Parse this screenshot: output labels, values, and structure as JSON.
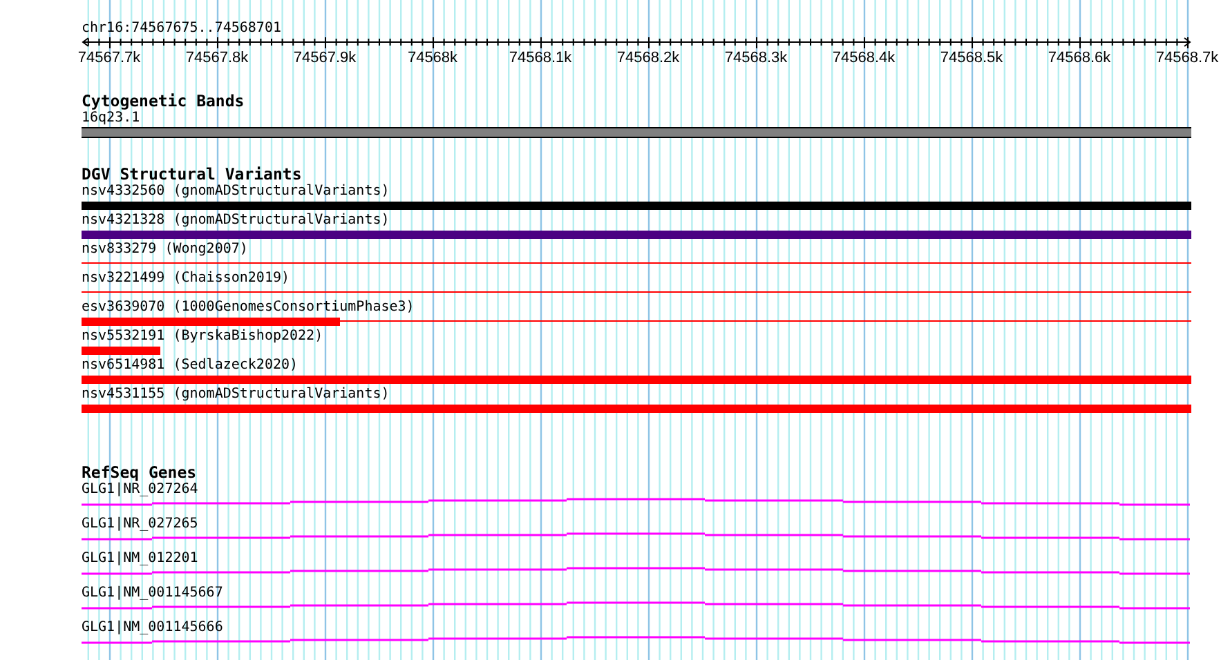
{
  "region": "chr16:74567675..74568701",
  "ruler": {
    "ticks": [
      "74567.7k",
      "74567.8k",
      "74567.9k",
      "74568k",
      "74568.1k",
      "74568.2k",
      "74568.3k",
      "74568.4k",
      "74568.5k",
      "74568.6k",
      "74568.7k"
    ]
  },
  "cytogenetic_bands": {
    "title": "Cytogenetic Bands",
    "band": "16q23.1"
  },
  "dgv": {
    "title": "DGV Structural Variants",
    "items": [
      {
        "label": "nsv4332560 (gnomADStructuralVariants)",
        "kind": "full_bar",
        "color": "#000000"
      },
      {
        "label": "nsv4321328 (gnomADStructuralVariants)",
        "kind": "full_bar",
        "color": "#4b0082"
      },
      {
        "label": "nsv833279 (Wong2007)",
        "kind": "line",
        "color": "#ff0000"
      },
      {
        "label": "nsv3221499 (Chaisson2019)",
        "kind": "line",
        "color": "#ff0000"
      },
      {
        "label": "esv3639070 (1000GenomesConsortiumPhase3)",
        "kind": "bar_line",
        "level": 0.233,
        "color": "#ff0000"
      },
      {
        "label": "nsv5532191 (ByrskaBishop2022)",
        "kind": "bar",
        "level": 0.071,
        "color": "#ff0000"
      },
      {
        "label": "nsv6514981 (Sedlazeck2020)",
        "kind": "full_bar",
        "color": "#ff0000"
      },
      {
        "label": "nsv4531155 (gnomADStructuralVariants)",
        "kind": "full_bar",
        "color": "#ff0000"
      }
    ]
  },
  "refseq_genes": {
    "title": "RefSeq Genes",
    "genes": [
      "GLG1|NR_027264",
      "GLG1|NR_027265",
      "GLG1|NM_012201",
      "GLG1|NM_001145667",
      "GLG1|NM_001145666"
    ]
  }
}
